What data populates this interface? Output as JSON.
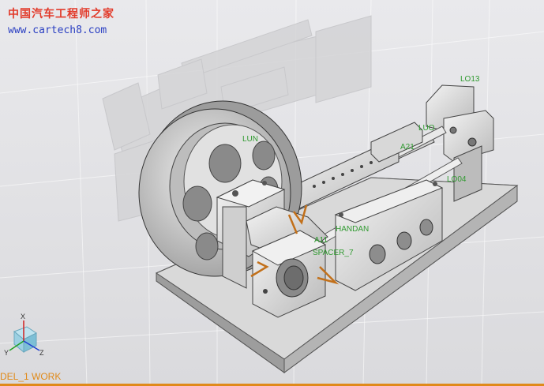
{
  "watermark": {
    "site_name_cn": "中国汽车工程师之家",
    "url": "www.cartech8.com"
  },
  "model_labels": {
    "lo13": "LO13",
    "luo": "LUO",
    "lun": "LUN",
    "a21": "A21",
    "lo04": "LO04",
    "handan": "HANDAN",
    "a11": "A11",
    "spacer7": "SPACER_7"
  },
  "triad": {
    "x": "X",
    "y": "Y",
    "z": "Z"
  },
  "status_bar": {
    "text": "DEL_1 WORK"
  },
  "colors": {
    "background": "#e3e3e6",
    "label_green": "#2f9a2f",
    "status_orange": "#e08a1a",
    "watermark_red": "#e23a2a",
    "watermark_blue": "#2a3fc2",
    "triad_x_red": "#d02020",
    "triad_y_green": "#20a020",
    "triad_z_blue": "#2040d0"
  },
  "icons": {
    "triad": "view-triad-icon",
    "joint_marker": "motion-joint-icon"
  }
}
